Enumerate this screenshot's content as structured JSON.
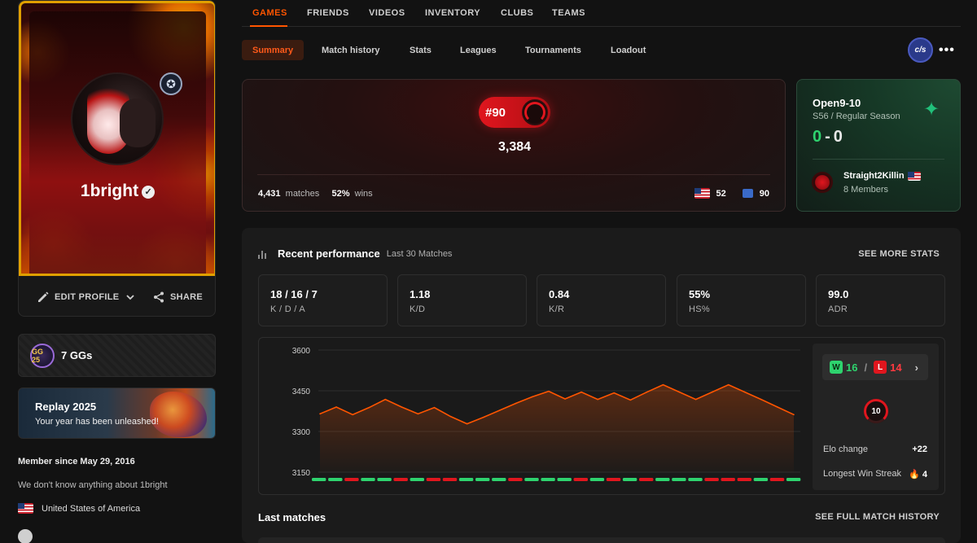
{
  "profile": {
    "username": "1bright",
    "edit_label": "EDIT PROFILE",
    "share_label": "SHARE",
    "ggs_badge": "GG 25",
    "ggs_label": "7 GGs",
    "replay_title": "Replay 2025",
    "replay_subtitle": "Your year has been unleashed!",
    "member_since": "Member since May 29, 2016",
    "about": "We don't know anything about 1bright",
    "country": "United States of America"
  },
  "nav": {
    "items": [
      "GAMES",
      "FRIENDS",
      "VIDEOS",
      "INVENTORY",
      "CLUBS",
      "TEAMS"
    ],
    "active": "GAMES"
  },
  "subtabs": {
    "items": [
      "Summary",
      "Match history",
      "Stats",
      "Leagues",
      "Tournaments",
      "Loadout"
    ],
    "active": "Summary",
    "game_logo": "c/s",
    "more": "•••"
  },
  "elo_card": {
    "rank": "#90",
    "elo": "3,384",
    "matches_value": "4,431",
    "matches_label": "matches",
    "wins_value": "52%",
    "wins_label": "wins",
    "country_rank": "52",
    "region_rank": "90"
  },
  "league": {
    "name": "Open9-10",
    "season": "S56 / Regular Season",
    "wins": "0",
    "separator": "-",
    "losses": "0",
    "team_name": "Straight2Killin",
    "team_members": "8 Members"
  },
  "performance": {
    "title": "Recent performance",
    "subtitle": "Last 30 Matches",
    "see_more": "SEE MORE STATS",
    "stats": [
      {
        "value": "18 / 16 / 7",
        "label": "K / D / A"
      },
      {
        "value": "1.18",
        "label": "K/D"
      },
      {
        "value": "0.84",
        "label": "K/R"
      },
      {
        "value": "55%",
        "label": "HS%"
      },
      {
        "value": "99.0",
        "label": "ADR"
      }
    ],
    "wins": "16",
    "losses": "14",
    "win_letter": "W",
    "loss_letter": "L",
    "level": "10",
    "elo_change_label": "Elo change",
    "elo_change_value": "+22",
    "streak_label": "Longest Win Streak",
    "streak_value": "4",
    "last_matches": "Last matches",
    "see_history": "SEE FULL MATCH HISTORY"
  },
  "chart_data": {
    "type": "area",
    "yticks": [
      "3600",
      "3450",
      "3300",
      "3150"
    ],
    "ylim": [
      3150,
      3600
    ],
    "x": [
      1,
      2,
      3,
      4,
      5,
      6,
      7,
      8,
      9,
      10,
      11,
      12,
      13,
      14,
      15,
      16,
      17,
      18,
      19,
      20,
      21,
      22,
      23,
      24,
      25,
      26,
      27,
      28,
      29,
      30
    ],
    "values": [
      3365,
      3390,
      3362,
      3388,
      3418,
      3390,
      3365,
      3388,
      3355,
      3328,
      3352,
      3378,
      3404,
      3428,
      3448,
      3420,
      3445,
      3418,
      3442,
      3416,
      3445,
      3472,
      3445,
      3418,
      3445,
      3472,
      3445,
      3418,
      3390,
      3362
    ],
    "results": [
      "W",
      "W",
      "L",
      "W",
      "W",
      "L",
      "W",
      "L",
      "L",
      "W",
      "W",
      "W",
      "L",
      "W",
      "W",
      "W",
      "L",
      "W",
      "L",
      "W",
      "L",
      "W",
      "W",
      "W",
      "L",
      "L",
      "L",
      "W",
      "L",
      "W"
    ],
    "colors": {
      "line": "#ff5500",
      "win": "#2ed36e",
      "loss": "#e0161e"
    }
  }
}
